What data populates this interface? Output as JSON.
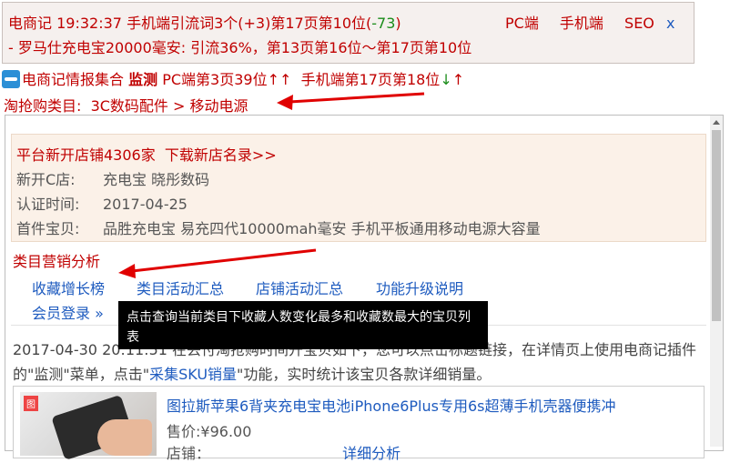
{
  "top": {
    "brand": "电商记",
    "time": "19:32:37",
    "line1_text": "手机端引流词3个(+3)第17页第10位(",
    "line1_change": "-73",
    "line1_end": ")",
    "links": [
      "PC端",
      "手机端",
      "SEO"
    ],
    "close": "x",
    "line2": "- 罗马仕充电宝20000毫安:  引流36%，第13页第16位～第17页第10位"
  },
  "info": {
    "app_name": "电商记情报集合",
    "monitor": "监测",
    "pc_rank": "PC端第3页39位",
    "pc_arrows": "↑↑",
    "mobile_rank": "手机端第17页第18位",
    "mobile_arrow_down": "↓",
    "mobile_arrow_up": "↑",
    "category_label": "淘抢购类目:",
    "category_path": "3C数码配件 > 移动电源"
  },
  "shop": {
    "new_shops": "平台新开店铺4306家",
    "download_link": "下载新店名录>>",
    "rows": [
      {
        "label": "新开C店:",
        "value": "充电宝 晓彤数码"
      },
      {
        "label": "认证时间:",
        "value": "2017-04-25"
      },
      {
        "label": "首件宝贝:",
        "value": "品胜充电宝 易充四代10000mah毫安 手机平板通用移动电源大容量"
      }
    ]
  },
  "marketing": {
    "title": "类目营销分析",
    "links": [
      "收藏增长榜",
      "类目活动汇总",
      "店铺活动汇总",
      "功能升级说明"
    ],
    "login": "会员登录 »"
  },
  "tooltip": "点击查询当前类目下收藏人数变化最多和收藏数最大的宝贝列表",
  "paragraph": {
    "date": "2017-04-30 20:11:51",
    "text1": "在丢付淘抢购时间开宝贝如下，您可以点击标题链接，在详情页上使用电商记插件的\"监测\"菜单，点击\"",
    "link": "采集SKU销量",
    "text2": "\"功能，实时统计该宝贝各款详细销量。"
  },
  "product": {
    "name": "图拉斯苹果6背夹充电宝电池iPhone6Plus专用6s超薄手机壳器便携冲",
    "price_label": "售价:",
    "price": "¥96.00",
    "more": "店铺：",
    "detail_link": "详细分析"
  },
  "colors": {
    "accent_red": "#c00000",
    "link_blue": "#1e5bbf",
    "arrow_red": "#e00000"
  }
}
